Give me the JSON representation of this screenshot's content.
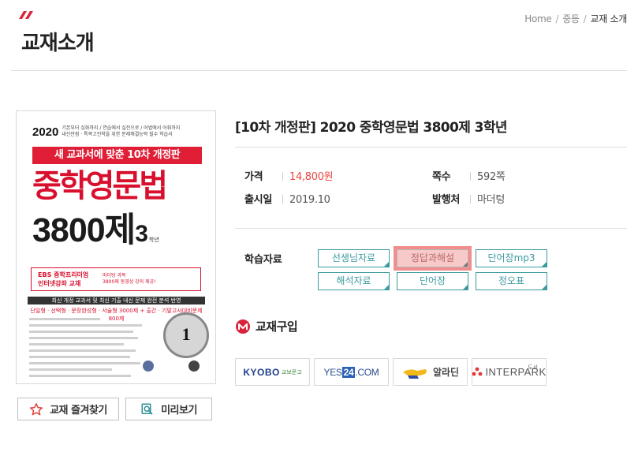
{
  "breadcrumb": {
    "home": "Home",
    "level2": "중등",
    "current": "교재 소개",
    "sep": "/"
  },
  "page_title": "교재소개",
  "cover": {
    "year": "2020",
    "tagline_1": "기본부터 심화까지 / 연습에서 실전으로 / 어법에서 어휘까지",
    "tagline_2": "내신만점 · 특목고진학을 위한 문제해결능력 필수 학습서",
    "banner": "새 교과서에 맞춘 10차 개정판",
    "main_title": "중학영문법",
    "number": "3800제",
    "grade_num": "3",
    "grade_text": "학년",
    "ebs_left_1": "EBS 중학프리미엄",
    "ebs_left_2": "인터넷강좌 교재",
    "ebs_right_1": "마더텅 과목",
    "ebs_right_2": "3800제 동영상 강의 제공!",
    "strip": "최신 개정 교과서 및 최신 기출 내신 문제 완전 분석 반영",
    "red_line": "단일형 · 선택형 · 문장완성형 · 서술형 3000제 + 출간 · 기말고사대비문제 800제",
    "stamp": "1"
  },
  "buttons": {
    "favorite": "교재 즐겨찾기",
    "preview": "미리보기"
  },
  "book": {
    "title": "[10차 개정판] 2020 중학영문법 3800제 3학년",
    "price_label": "가격",
    "price": "14,800원",
    "pages_label": "쪽수",
    "pages": "592쪽",
    "date_label": "출시일",
    "date": "2019.10",
    "publisher_label": "발행처",
    "publisher": "마더텅"
  },
  "study": {
    "label": "학습자료",
    "items": [
      "선생님자료",
      "정답과해설",
      "단어장mp3",
      "해석자료",
      "단어장",
      "정오표"
    ]
  },
  "buy": {
    "title": "교재구입",
    "stores": {
      "kyobo": "KYOBO",
      "kyobo_sub": "교보문고",
      "yes24_a": "YES",
      "yes24_b": "24",
      "yes24_c": ".COM",
      "aladin": "알라딘",
      "interpark": "INTERPARK",
      "interpark_sub": "도서"
    }
  },
  "colors": {
    "accent_red": "#e01f36",
    "teal": "#3d9aa0",
    "price": "#e8473f",
    "active_highlight": "#f28e8e"
  }
}
